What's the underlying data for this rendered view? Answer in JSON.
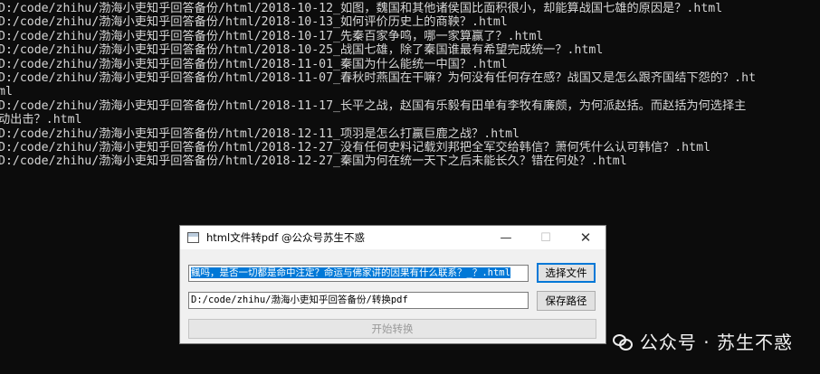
{
  "console": {
    "lines": [
      "D:/code/zhihu/渤海小吏知乎回答备份/html/2018-10-12_如图，魏国和其他诸侯国比面积很小，却能算战国七雄的原因是？.html",
      "D:/code/zhihu/渤海小吏知乎回答备份/html/2018-10-13_如何评价历史上的商鞅？.html",
      "D:/code/zhihu/渤海小吏知乎回答备份/html/2018-10-17_先秦百家争鸣，哪一家算赢了？.html",
      "D:/code/zhihu/渤海小吏知乎回答备份/html/2018-10-25_战国七雄，除了秦国谁最有希望完成统一？.html",
      "D:/code/zhihu/渤海小吏知乎回答备份/html/2018-11-01_秦国为什么能统一中国？.html",
      "D:/code/zhihu/渤海小吏知乎回答备份/html/2018-11-07_春秋时燕国在干嘛？为何没有任何存在感？战国又是怎么跟齐国结下怨的？.ht",
      "ml",
      "D:/code/zhihu/渤海小吏知乎回答备份/html/2018-11-17_长平之战，赵国有乐毅有田单有李牧有廉颇，为何派赵括。而赵括为何选择主",
      "动出击？.html",
      "D:/code/zhihu/渤海小吏知乎回答备份/html/2018-12-11_项羽是怎么打赢巨鹿之战？.html",
      "D:/code/zhihu/渤海小吏知乎回答备份/html/2018-12-27_没有任何史料记载刘邦把全军交给韩信？萧何凭什么认可韩信？.html",
      "D:/code/zhihu/渤海小吏知乎回答备份/html/2018-12-27_秦国为何在统一天下之后未能长久？错在何处？.html"
    ]
  },
  "dialog": {
    "title": "html文件转pdf @公众号苏生不惑",
    "minimize_glyph": "—",
    "maximize_glyph": "☐",
    "close_glyph": "✕",
    "file_field_value": "鲺吗，是否一切都是命中注定？命运与佛家讲的因果有什么联系？_？.html",
    "select_file_label": "选择文件",
    "path_field_value": "D:/code/zhihu/渤海小吏知乎回答备份/转换pdf",
    "save_path_label": "保存路径",
    "start_label": "开始转换"
  },
  "watermark": {
    "text": "公众号 · 苏生不惑",
    "icon": "wechat-icon"
  }
}
